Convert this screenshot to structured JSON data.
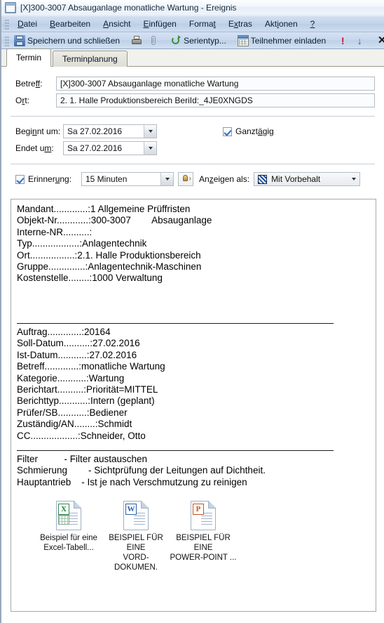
{
  "window": {
    "title": "[X]300-3007 Absauganlage monatliche Wartung - Ereignis",
    "icon": "calendar-icon"
  },
  "menubar": {
    "items": [
      {
        "label": "Datei",
        "accel": "D"
      },
      {
        "label": "Bearbeiten",
        "accel": "B"
      },
      {
        "label": "Ansicht",
        "accel": "A"
      },
      {
        "label": "Einfügen",
        "accel": "E"
      },
      {
        "label": "Format",
        "accel": "t"
      },
      {
        "label": "Extras",
        "accel": "x"
      },
      {
        "label": "Aktionen",
        "accel": "i"
      },
      {
        "label": "?",
        "accel": "?"
      }
    ]
  },
  "toolbar": {
    "save_close_label": "Speichern und schließen",
    "serientyp_label": "Serientyp...",
    "invite_label": "Teilnehmer einladen",
    "icons": [
      "save-icon",
      "print-icon",
      "attachment-icon",
      "recurrence-icon",
      "invite-attendees-icon",
      "importance-high-icon",
      "importance-low-icon",
      "delete-icon",
      "previous-item-icon"
    ]
  },
  "tabs": [
    {
      "label": "Termin",
      "active": true
    },
    {
      "label": "Terminplanung",
      "active": false
    }
  ],
  "form": {
    "betreff_label": "Betreff:",
    "betreff_value": "[X]300-3007 Absauganlage monatliche Wartung",
    "ort_label": "Ort:",
    "ort_value": "2. 1. Halle Produktionsbereich BeriId:_4JE0XNGDS",
    "beginnt_label": "Beginnt um:",
    "beginnt_value": "Sa 27.02.2016",
    "endet_label": "Endet um:",
    "endet_value": "Sa 27.02.2016",
    "ganztaegig_label": "Ganztägig",
    "ganztaegig_checked": true,
    "erinnerung_label": "Erinnerung:",
    "erinnerung_checked": true,
    "erinnerung_value": "15 Minuten",
    "sound_icon": "reminder-sound-icon",
    "anzeigen_label": "Anzeigen als:",
    "anzeigen_value": "Mit Vorbehalt",
    "anzeigen_swatch": "#1d4f9e"
  },
  "note": {
    "block1": [
      "Mandant.............:1 Allgemeine Prüffristen",
      "Objekt-Nr............:300-3007        Absauganlage",
      "Interne-NR..........:",
      "Typ..................:Anlagentechnik",
      "Ort.................:2.1. Halle Produktionsbereich",
      "Gruppe..............:Anlagentechnik-Maschinen",
      "Kostenstelle........:1000 Verwaltung"
    ],
    "block2": [
      "Auftrag.............:20164",
      "Soll-Datum..........:27.02.2016",
      "Ist-Datum...........:27.02.2016",
      "Betreff.............:monatliche Wartung",
      "Kategorie...........:Wartung",
      "Berichtart..........:Priorität=MITTEL",
      "Berichttyp...........:Intern (geplant)",
      "Prüfer/SB...........:Bediener",
      "Zuständig/AN........:Schmidt",
      "CC..................:Schneider, Otto"
    ],
    "block3": [
      "Filter          - Filter austauschen",
      "Schmierung        - Sichtprüfung der Leitungen auf Dichtheit.",
      "Hauptantrieb    - Ist je nach Verschmutzung zu reinigen"
    ],
    "attachments": [
      {
        "name": "Beispiel für eine\nExcel-Tabell...",
        "type": "excel",
        "badge": "X"
      },
      {
        "name": "BEISPIEL FÜR EINE\nVORD-DOKUMEN.",
        "type": "word",
        "badge": "W"
      },
      {
        "name": "BEISPIEL FÜR EINE\nPOWER-POINT ...",
        "type": "powerpoint",
        "badge": "P"
      }
    ]
  }
}
